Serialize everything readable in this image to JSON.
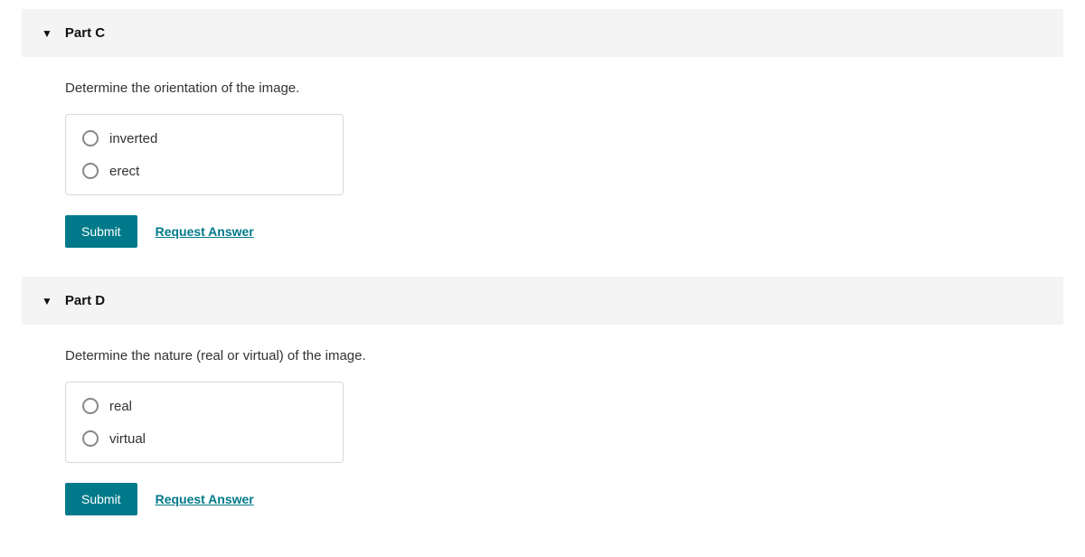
{
  "parts": [
    {
      "title": "Part C",
      "prompt": "Determine the orientation of the image.",
      "options": [
        "inverted",
        "erect"
      ],
      "submit_label": "Submit",
      "request_label": "Request Answer"
    },
    {
      "title": "Part D",
      "prompt": "Determine the nature (real or virtual) of the image.",
      "options": [
        "real",
        "virtual"
      ],
      "submit_label": "Submit",
      "request_label": "Request Answer"
    }
  ]
}
